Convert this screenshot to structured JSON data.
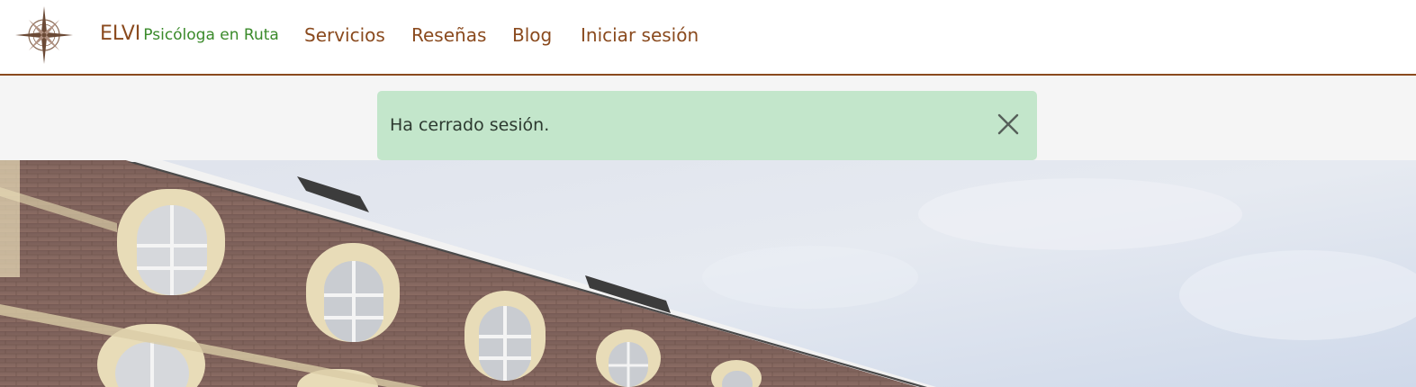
{
  "brand": {
    "name": "ELVI",
    "tagline": "Psicóloga en Ruta",
    "logo_icon": "compass-rose-icon"
  },
  "nav": {
    "items": [
      {
        "label": "Servicios"
      },
      {
        "label": "Reseñas"
      },
      {
        "label": "Blog"
      },
      {
        "label": "Iniciar sesión"
      }
    ]
  },
  "alert": {
    "message": "Ha cerrado sesión.",
    "close_icon": "close-icon",
    "background_color": "#c3e6cb"
  },
  "hero": {
    "image_icon": "brick-building-photo"
  },
  "colors": {
    "accent": "#8a4a1e",
    "tagline": "#3a8a2a"
  }
}
